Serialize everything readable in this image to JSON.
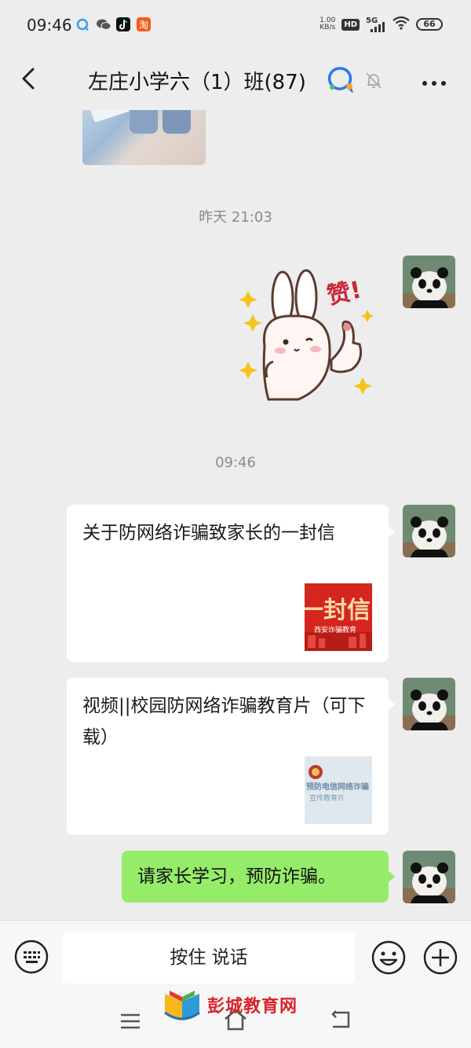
{
  "status_bar": {
    "time": "09:46",
    "net_speed_value": "1.00",
    "net_speed_unit": "KB/s",
    "hd": "HD",
    "network": "5G",
    "battery": "66",
    "left_icons": [
      "qq-browser-icon",
      "wechat-icon",
      "tiktok-icon",
      "taobao-icon"
    ]
  },
  "header": {
    "title": "左庄小学六（1）班(87)"
  },
  "messages": {
    "ts1": "昨天 21:03",
    "sticker_text": "赞!",
    "ts2": "09:46",
    "card1": {
      "title": "关于防网络诈骗致家长的一封信",
      "thumb_text": "一封信",
      "thumb_caption": "西安诈骗教育"
    },
    "card2": {
      "title": "视频||校园防网络诈骗教育片（可下载）",
      "thumb_text": "预防电信网络诈骗",
      "thumb_caption": "宣传教育片"
    },
    "text1": "请家长学习，预防诈骗。"
  },
  "input": {
    "hold_to_talk": "按住 说话"
  },
  "watermark": {
    "text": "彭城教育网"
  },
  "colors": {
    "background": "#ededed",
    "bubble_green": "#95ec69",
    "bubble_white": "#ffffff"
  }
}
